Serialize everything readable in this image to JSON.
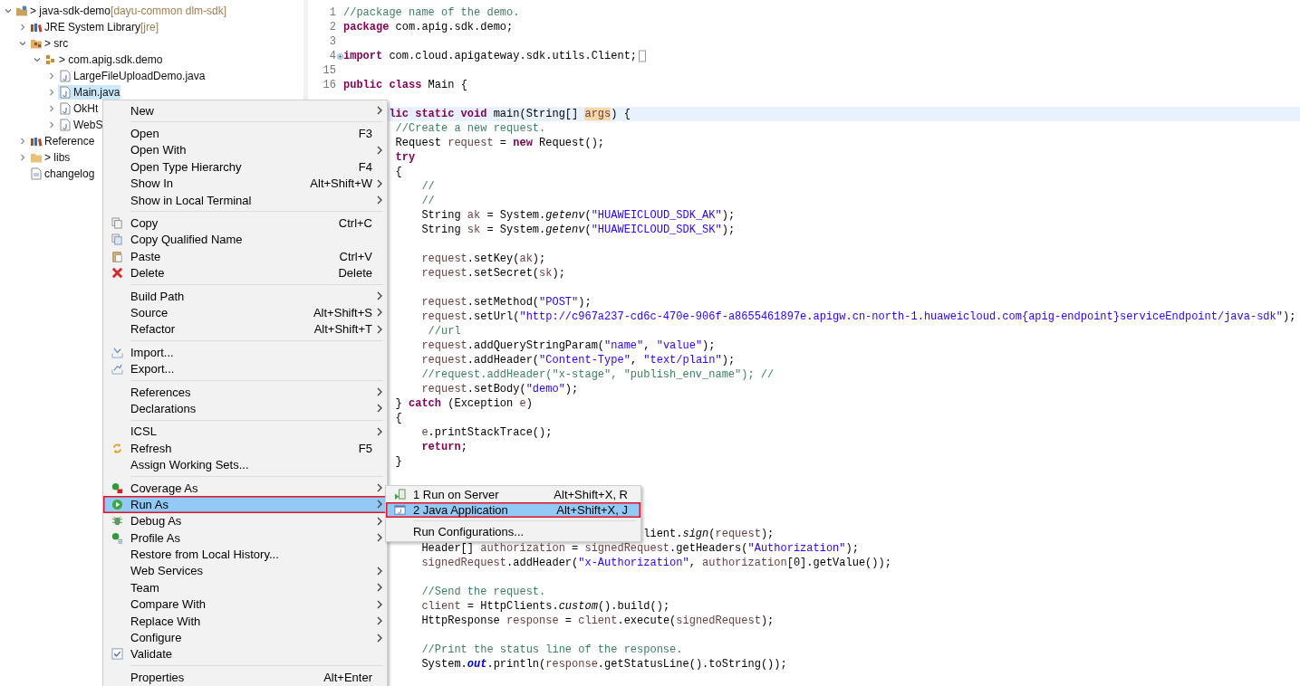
{
  "explorer": {
    "items": [
      {
        "label": "> java-sdk-demo",
        "decoration": "[dayu-common dlm-sdk]",
        "kind": "project",
        "expanded": true,
        "selected": false,
        "children": [
          {
            "label": "JRE System Library",
            "decoration": "[jre]",
            "kind": "library",
            "expanded": false,
            "selected": false
          },
          {
            "label": "> src",
            "kind": "source-folder",
            "expanded": true,
            "selected": false,
            "children": [
              {
                "label": "> com.apig.sdk.demo",
                "kind": "package",
                "expanded": true,
                "selected": false,
                "children": [
                  {
                    "label": "LargeFileUploadDemo.java",
                    "kind": "java-file",
                    "expanded": false,
                    "selected": false
                  },
                  {
                    "label": "Main.java",
                    "kind": "java-file",
                    "expanded": false,
                    "selected": true
                  },
                  {
                    "label": "OkHt",
                    "kind": "java-file",
                    "expanded": false,
                    "selected": false
                  },
                  {
                    "label": "WebS",
                    "kind": "java-file",
                    "expanded": false,
                    "selected": false
                  }
                ]
              }
            ]
          },
          {
            "label": "Reference",
            "kind": "library",
            "expanded": false,
            "selected": false
          },
          {
            "label": "> libs",
            "kind": "folder",
            "expanded": false,
            "selected": false
          },
          {
            "label": "changelog",
            "kind": "file",
            "selected": false
          }
        ]
      }
    ]
  },
  "editor": {
    "lines": [
      {
        "number": "1",
        "current": false,
        "folded": false,
        "tokens": [
          {
            "kind": "comment",
            "text": "//package name of the demo."
          }
        ]
      },
      {
        "number": "2",
        "current": false,
        "folded": false,
        "tokens": [
          {
            "kind": "keyword",
            "text": "package"
          },
          {
            "kind": "plain",
            "text": " com.apig.sdk.demo;"
          }
        ]
      },
      {
        "number": "3",
        "current": false,
        "folded": false
      },
      {
        "number": "4",
        "current": false,
        "folded": true,
        "tokens": [
          {
            "kind": "keyword",
            "text": "import"
          },
          {
            "kind": "plain",
            "text": " com.cloud.apigateway.sdk.utils.Client;"
          }
        ]
      },
      {
        "number": "15",
        "current": false,
        "folded": false
      },
      {
        "number": "16",
        "current": false,
        "folded": false,
        "tokens": [
          {
            "kind": "keyword",
            "text": "public class"
          },
          {
            "kind": "plain",
            "text": " Main {"
          }
        ]
      },
      {
        "current": false
      },
      {
        "current": true,
        "tokens": [
          {
            "kind": "keyword",
            "text": "       lic static void"
          },
          {
            "kind": "plain",
            "text": " main(String[] "
          },
          {
            "kind": "occurrence",
            "text": "args"
          },
          {
            "kind": "plain",
            "text": ") {"
          }
        ]
      },
      {
        "current": false,
        "tokens": [
          {
            "kind": "comment",
            "text": "        //Create a new request."
          }
        ]
      },
      {
        "current": false,
        "tokens": [
          {
            "kind": "plain",
            "text": "        Request "
          },
          {
            "kind": "var",
            "text": "request"
          },
          {
            "kind": "plain",
            "text": " = "
          },
          {
            "kind": "keyword",
            "text": "new"
          },
          {
            "kind": "plain",
            "text": " Request();"
          }
        ]
      },
      {
        "current": false,
        "tokens": [
          {
            "kind": "keyword",
            "text": "        try"
          }
        ]
      },
      {
        "current": false,
        "tokens": [
          {
            "kind": "plain",
            "text": "        {"
          }
        ]
      },
      {
        "current": false,
        "tokens": [
          {
            "kind": "comment",
            "text": "            //"
          }
        ]
      },
      {
        "current": false,
        "tokens": [
          {
            "kind": "comment",
            "text": "            //"
          }
        ]
      },
      {
        "current": false,
        "tokens": [
          {
            "kind": "plain",
            "text": "            String "
          },
          {
            "kind": "var",
            "text": "ak"
          },
          {
            "kind": "plain",
            "text": " = System."
          },
          {
            "kind": "method",
            "text": "getenv"
          },
          {
            "kind": "plain",
            "text": "("
          },
          {
            "kind": "string",
            "text": "\"HUAWEICLOUD_SDK_AK\""
          },
          {
            "kind": "plain",
            "text": ");"
          }
        ]
      },
      {
        "current": false,
        "tokens": [
          {
            "kind": "plain",
            "text": "            String "
          },
          {
            "kind": "var",
            "text": "sk"
          },
          {
            "kind": "plain",
            "text": " = System."
          },
          {
            "kind": "method",
            "text": "getenv"
          },
          {
            "kind": "plain",
            "text": "("
          },
          {
            "kind": "string",
            "text": "\"HUAWEICLOUD_SDK_SK\""
          },
          {
            "kind": "plain",
            "text": ");"
          }
        ]
      },
      {
        "current": false
      },
      {
        "current": false,
        "tokens": [
          {
            "kind": "var",
            "text": "            request"
          },
          {
            "kind": "plain",
            "text": ".setKey("
          },
          {
            "kind": "var",
            "text": "ak"
          },
          {
            "kind": "plain",
            "text": ");"
          }
        ]
      },
      {
        "current": false,
        "tokens": [
          {
            "kind": "var",
            "text": "            request"
          },
          {
            "kind": "plain",
            "text": ".setSecret("
          },
          {
            "kind": "var",
            "text": "sk"
          },
          {
            "kind": "plain",
            "text": ");"
          }
        ]
      },
      {
        "current": false
      },
      {
        "current": false,
        "tokens": [
          {
            "kind": "var",
            "text": "            request"
          },
          {
            "kind": "plain",
            "text": ".setMethod("
          },
          {
            "kind": "string",
            "text": "\"POST\""
          },
          {
            "kind": "plain",
            "text": ");"
          }
        ]
      },
      {
        "current": false,
        "tokens": [
          {
            "kind": "var",
            "text": "            request"
          },
          {
            "kind": "plain",
            "text": ".setUrl("
          },
          {
            "kind": "string",
            "text": "\"http://c967a237-cd6c-470e-906f-a8655461897e.apigw.cn-north-1.huaweicloud.com{apig-endpoint}serviceEndpoint/java-sdk\""
          },
          {
            "kind": "plain",
            "text": ");"
          }
        ]
      },
      {
        "current": false,
        "tokens": [
          {
            "kind": "comment",
            "text": "             //url"
          }
        ]
      },
      {
        "current": false,
        "tokens": [
          {
            "kind": "var",
            "text": "            request"
          },
          {
            "kind": "plain",
            "text": ".addQueryStringParam("
          },
          {
            "kind": "string",
            "text": "\"name\""
          },
          {
            "kind": "plain",
            "text": ", "
          },
          {
            "kind": "string",
            "text": "\"value\""
          },
          {
            "kind": "plain",
            "text": ");"
          }
        ]
      },
      {
        "current": false,
        "tokens": [
          {
            "kind": "var",
            "text": "            request"
          },
          {
            "kind": "plain",
            "text": ".addHeader("
          },
          {
            "kind": "string",
            "text": "\"Content-Type\""
          },
          {
            "kind": "plain",
            "text": ", "
          },
          {
            "kind": "string",
            "text": "\"text/plain\""
          },
          {
            "kind": "plain",
            "text": ");"
          }
        ]
      },
      {
        "current": false,
        "tokens": [
          {
            "kind": "comment",
            "text": "            //request.addHeader(\"x-stage\", \"publish_env_name\"); //"
          }
        ]
      },
      {
        "current": false,
        "tokens": [
          {
            "kind": "var",
            "text": "            request"
          },
          {
            "kind": "plain",
            "text": ".setBody("
          },
          {
            "kind": "string",
            "text": "\"demo\""
          },
          {
            "kind": "plain",
            "text": ");"
          }
        ]
      },
      {
        "current": false,
        "tokens": [
          {
            "kind": "plain",
            "text": "        } "
          },
          {
            "kind": "keyword",
            "text": "catch"
          },
          {
            "kind": "plain",
            "text": " (Exception "
          },
          {
            "kind": "var",
            "text": "e"
          },
          {
            "kind": "plain",
            "text": ")"
          }
        ]
      },
      {
        "current": false,
        "tokens": [
          {
            "kind": "plain",
            "text": "        {"
          }
        ]
      },
      {
        "current": false,
        "tokens": [
          {
            "kind": "var",
            "text": "            e"
          },
          {
            "kind": "plain",
            "text": ".printStackTrace();"
          }
        ]
      },
      {
        "current": false,
        "tokens": [
          {
            "kind": "keyword",
            "text": "            return"
          },
          {
            "kind": "plain",
            "text": ";"
          }
        ]
      },
      {
        "current": false,
        "tokens": [
          {
            "kind": "plain",
            "text": "        }"
          }
        ]
      },
      {
        "current": false
      },
      {
        "current": false
      },
      {
        "current": false
      },
      {
        "current": false
      },
      {
        "current": false,
        "tokens": [
          {
            "kind": "plain",
            "text": "                                              lient."
          },
          {
            "kind": "method",
            "text": "sign"
          },
          {
            "kind": "plain",
            "text": "("
          },
          {
            "kind": "var",
            "text": "request"
          },
          {
            "kind": "plain",
            "text": ");"
          }
        ]
      },
      {
        "current": false,
        "tokens": [
          {
            "kind": "plain",
            "text": "            Header[] "
          },
          {
            "kind": "var",
            "text": "authorization"
          },
          {
            "kind": "plain",
            "text": " = "
          },
          {
            "kind": "var",
            "text": "signedRequest"
          },
          {
            "kind": "plain",
            "text": ".getHeaders("
          },
          {
            "kind": "string",
            "text": "\"Authorization\""
          },
          {
            "kind": "plain",
            "text": ");"
          }
        ]
      },
      {
        "current": false,
        "tokens": [
          {
            "kind": "var",
            "text": "            signedRequest"
          },
          {
            "kind": "plain",
            "text": ".addHeader("
          },
          {
            "kind": "string",
            "text": "\"x-Authorization\""
          },
          {
            "kind": "plain",
            "text": ", "
          },
          {
            "kind": "var",
            "text": "authorization"
          },
          {
            "kind": "plain",
            "text": "[0].getValue());"
          }
        ]
      },
      {
        "current": false
      },
      {
        "current": false,
        "tokens": [
          {
            "kind": "comment",
            "text": "            //Send the request."
          }
        ]
      },
      {
        "current": false,
        "tokens": [
          {
            "kind": "var",
            "text": "            client"
          },
          {
            "kind": "plain",
            "text": " = HttpClients."
          },
          {
            "kind": "method",
            "text": "custom"
          },
          {
            "kind": "plain",
            "text": "().build();"
          }
        ]
      },
      {
        "current": false,
        "tokens": [
          {
            "kind": "plain",
            "text": "            HttpResponse "
          },
          {
            "kind": "var",
            "text": "response"
          },
          {
            "kind": "plain",
            "text": " = "
          },
          {
            "kind": "var",
            "text": "client"
          },
          {
            "kind": "plain",
            "text": ".execute("
          },
          {
            "kind": "var",
            "text": "signedRequest"
          },
          {
            "kind": "plain",
            "text": ");"
          }
        ]
      },
      {
        "current": false
      },
      {
        "current": false,
        "tokens": [
          {
            "kind": "comment",
            "text": "            //Print the status line of the response."
          }
        ]
      },
      {
        "current": false,
        "tokens": [
          {
            "kind": "plain",
            "text": "            System."
          },
          {
            "kind": "field",
            "text": "out"
          },
          {
            "kind": "plain",
            "text": ".println("
          },
          {
            "kind": "var",
            "text": "response"
          },
          {
            "kind": "plain",
            "text": ".getStatusLine().toString());"
          }
        ]
      }
    ]
  },
  "context_menu": {
    "groups": [
      [
        {
          "label": "New",
          "kind": "plain",
          "submenu": true,
          "selected": false,
          "outlined": false
        }
      ],
      [
        {
          "label": "Open",
          "shortcut": "F3",
          "kind": "plain",
          "submenu": false,
          "selected": false,
          "outlined": false
        },
        {
          "label": "Open With",
          "kind": "plain",
          "submenu": true,
          "selected": false,
          "outlined": false
        },
        {
          "label": "Open Type Hierarchy",
          "shortcut": "F4",
          "kind": "plain",
          "submenu": false,
          "selected": false,
          "outlined": false
        },
        {
          "label": "Show In",
          "shortcut": "Alt+Shift+W",
          "kind": "plain",
          "submenu": true,
          "selected": false,
          "outlined": false
        },
        {
          "label": "Show in Local Terminal",
          "kind": "plain",
          "submenu": true,
          "selected": false,
          "outlined": false
        }
      ],
      [
        {
          "label": "Copy",
          "shortcut": "Ctrl+C",
          "kind": "copy",
          "selected": false,
          "outlined": false
        },
        {
          "label": "Copy Qualified Name",
          "kind": "copy-qualified",
          "selected": false,
          "outlined": false
        },
        {
          "label": "Paste",
          "shortcut": "Ctrl+V",
          "kind": "paste",
          "submenu": false,
          "selected": false,
          "outlined": false
        },
        {
          "label": "Delete",
          "shortcut": "Delete",
          "kind": "delete",
          "submenu": false,
          "selected": false,
          "outlined": false
        }
      ],
      [
        {
          "label": "Build Path",
          "kind": "plain",
          "submenu": true,
          "selected": false,
          "outlined": false
        },
        {
          "label": "Source",
          "shortcut": "Alt+Shift+S",
          "kind": "plain",
          "submenu": true,
          "selected": false,
          "outlined": false
        },
        {
          "label": "Refactor",
          "shortcut": "Alt+Shift+T",
          "kind": "plain",
          "submenu": true,
          "selected": false,
          "outlined": false
        }
      ],
      [
        {
          "label": "Import...",
          "kind": "import",
          "selected": false,
          "outlined": false
        },
        {
          "label": "Export...",
          "kind": "export",
          "selected": false,
          "outlined": false
        }
      ],
      [
        {
          "label": "References",
          "kind": "plain",
          "submenu": true,
          "selected": false,
          "outlined": false
        },
        {
          "label": "Declarations",
          "kind": "plain",
          "submenu": true,
          "selected": false,
          "outlined": false
        }
      ],
      [
        {
          "label": "ICSL",
          "kind": "plain",
          "submenu": true,
          "selected": false,
          "outlined": false
        },
        {
          "label": "Refresh",
          "shortcut": "F5",
          "kind": "refresh",
          "submenu": false,
          "selected": false,
          "outlined": false
        },
        {
          "label": "Assign Working Sets...",
          "kind": "plain",
          "submenu": false,
          "selected": false,
          "outlined": false
        }
      ],
      [
        {
          "label": "Coverage As",
          "kind": "coverage",
          "submenu": true,
          "selected": false,
          "outlined": false
        },
        {
          "label": "Run As",
          "kind": "run",
          "submenu": true,
          "selected": true,
          "outlined": true
        },
        {
          "label": "Debug As",
          "kind": "debug",
          "submenu": true,
          "selected": false,
          "outlined": false
        },
        {
          "label": "Profile As",
          "kind": "profile",
          "submenu": true,
          "selected": false,
          "outlined": false
        },
        {
          "label": "Restore from Local History...",
          "kind": "plain",
          "submenu": false,
          "selected": false,
          "outlined": false
        },
        {
          "label": "Web Services",
          "kind": "plain",
          "submenu": true,
          "selected": false,
          "outlined": false
        },
        {
          "label": "Team",
          "kind": "plain",
          "submenu": true,
          "selected": false,
          "outlined": false
        },
        {
          "label": "Compare With",
          "kind": "plain",
          "submenu": true,
          "selected": false,
          "outlined": false
        },
        {
          "label": "Replace With",
          "kind": "plain",
          "submenu": true,
          "selected": false,
          "outlined": false
        },
        {
          "label": "Configure",
          "kind": "plain",
          "submenu": true,
          "selected": false,
          "outlined": false
        },
        {
          "label": "Validate",
          "kind": "check",
          "selected": false,
          "outlined": false
        }
      ],
      [
        {
          "label": "Properties",
          "shortcut": "Alt+Enter",
          "kind": "plain",
          "submenu": false,
          "selected": false,
          "outlined": false
        }
      ]
    ]
  },
  "run_as_submenu": {
    "groups": [
      [
        {
          "label": "1 Run on Server",
          "shortcut": "Alt+Shift+X, R",
          "kind": "server",
          "selected": false,
          "outlined": false
        },
        {
          "label": "2 Java Application",
          "shortcut": "Alt+Shift+X, J",
          "kind": "java-app",
          "selected": true,
          "outlined": true
        }
      ],
      [
        {
          "label": "Run Configurations...",
          "kind": "plain",
          "selected": false,
          "outlined": false
        }
      ]
    ]
  }
}
